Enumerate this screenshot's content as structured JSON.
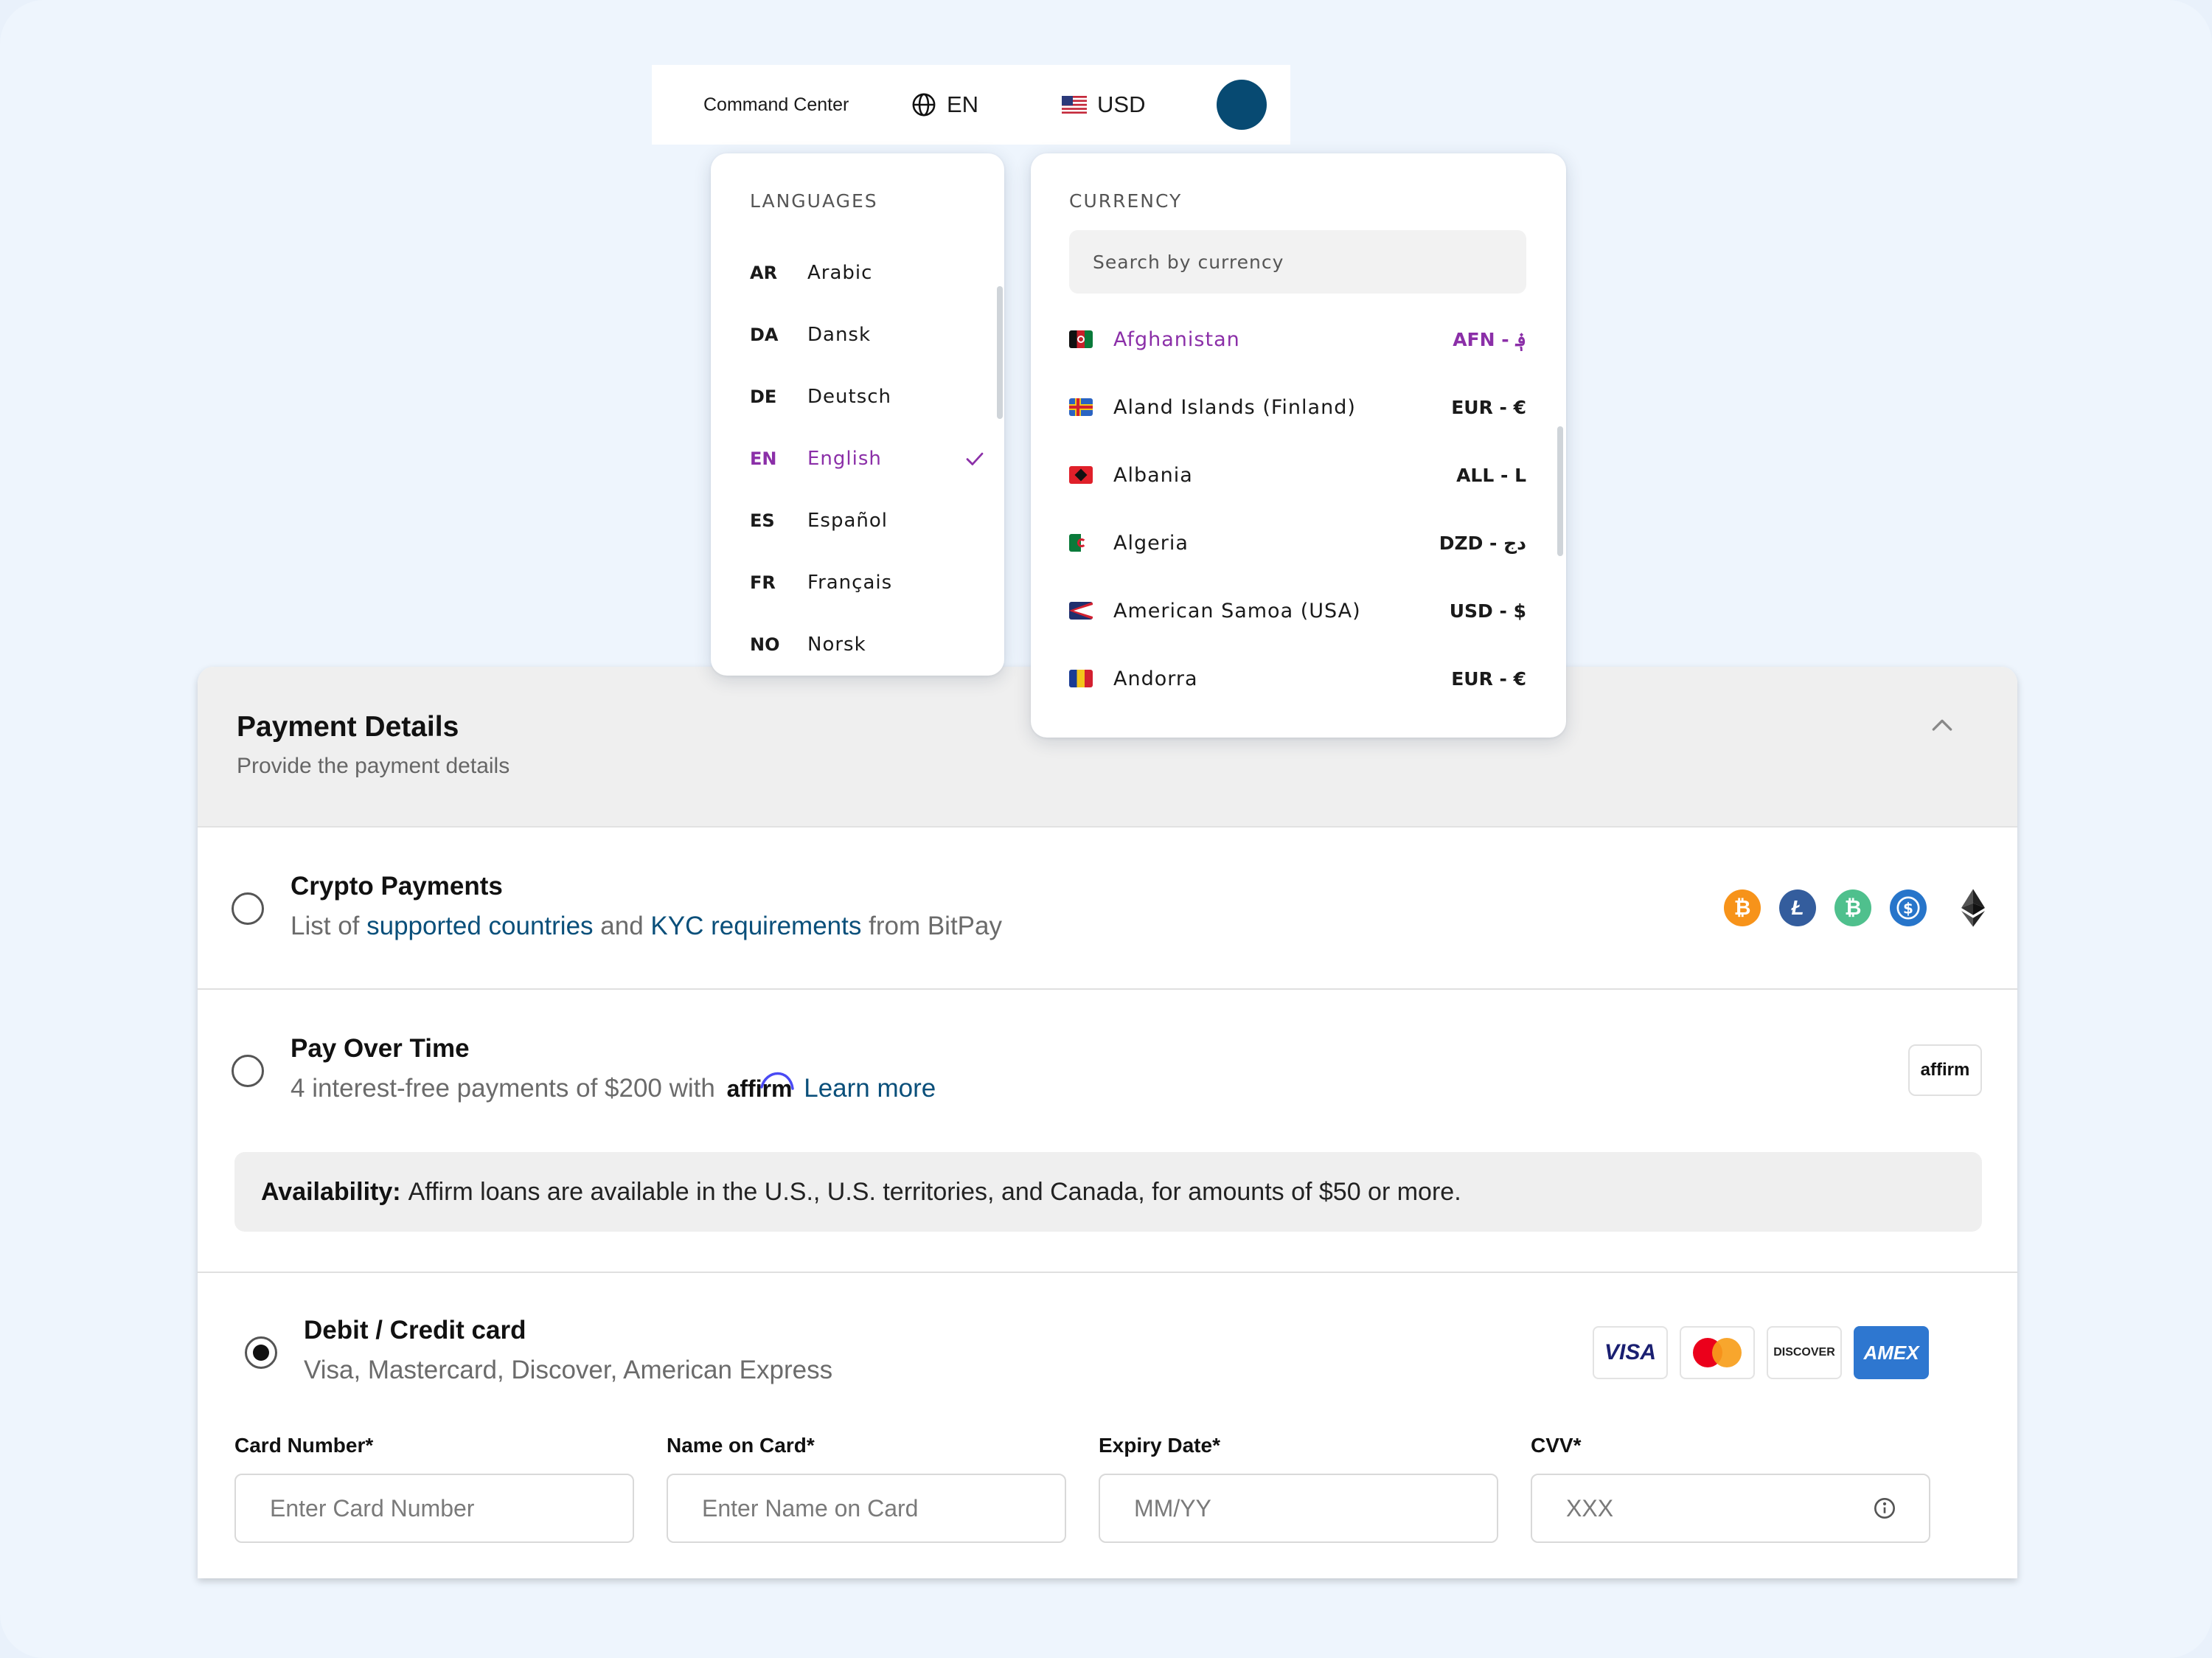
{
  "topbar": {
    "command_center": "Command Center",
    "language_code": "EN",
    "currency_code": "USD"
  },
  "languages": {
    "title": "LANGUAGES",
    "items": [
      {
        "code": "AR",
        "name": "Arabic"
      },
      {
        "code": "DA",
        "name": "Dansk"
      },
      {
        "code": "DE",
        "name": "Deutsch"
      },
      {
        "code": "EN",
        "name": "English",
        "selected": true
      },
      {
        "code": "ES",
        "name": "Español"
      },
      {
        "code": "FR",
        "name": "Français"
      },
      {
        "code": "NO",
        "name": "Norsk"
      }
    ]
  },
  "currency": {
    "title": "CURRENCY",
    "search_placeholder": "Search by currency",
    "items": [
      {
        "country": "Afghanistan",
        "code": "AFN - ؋",
        "highlighted": true
      },
      {
        "country": "Aland Islands (Finland)",
        "code": "EUR - €"
      },
      {
        "country": "Albania",
        "code": "ALL - L"
      },
      {
        "country": "Algeria",
        "code": "DZD - دج"
      },
      {
        "country": "American Samoa (USA)",
        "code": "USD - $"
      },
      {
        "country": "Andorra",
        "code": "EUR - €"
      }
    ]
  },
  "payment": {
    "title": "Payment Details",
    "subtitle": "Provide the payment details",
    "crypto": {
      "title": "Crypto Payments",
      "sub_prefix": "List of",
      "link1": "supported countries",
      "sub_mid": "and",
      "link2": "KYC requirements",
      "sub_suffix": "from BitPay"
    },
    "paylater": {
      "title": "Pay Over Time",
      "sub_prefix": "4 interest-free payments of $200 with",
      "affirm": "affirm",
      "link": "Learn more",
      "badge": "affirm",
      "availability_label": "Availability:",
      "availability_text": "Affirm loans are available in the U.S., U.S. territories, and Canada, for amounts of $50 or more."
    },
    "card": {
      "title": "Debit / Credit card",
      "subtitle": "Visa, Mastercard, Discover, American Express",
      "logos": {
        "visa": "VISA",
        "discover": "DISCOVER",
        "amex": "AMEX"
      },
      "fields": {
        "number_label": "Card Number*",
        "number_placeholder": "Enter Card Number",
        "name_label": "Name on Card*",
        "name_placeholder": "Enter Name on Card",
        "expiry_label": "Expiry Date*",
        "expiry_placeholder": "MM/YY",
        "cvv_label": "CVV*",
        "cvv_placeholder": "XXX"
      }
    }
  },
  "colors": {
    "accent_purple": "#8b2fa8",
    "link_blue": "#0a4f7a",
    "avatar": "#074a72",
    "bitcoin": "#f7931a",
    "litecoin": "#345d9d",
    "bitcoin_cash": "#4fc08d",
    "usdc": "#2775ca"
  },
  "icons": [
    "globe-icon",
    "us-flag-icon",
    "check-icon",
    "chevron-up-icon",
    "bitcoin-icon",
    "litecoin-icon",
    "bitcoin-cash-icon",
    "usdc-icon",
    "ethereum-icon",
    "info-icon"
  ]
}
